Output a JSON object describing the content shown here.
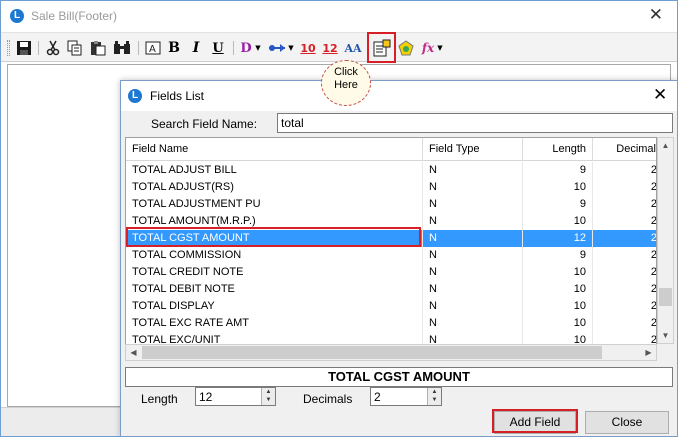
{
  "main_window": {
    "title": "Sale Bill(Footer)",
    "app_icon": "L",
    "close_glyph": "✕"
  },
  "toolbar": {
    "icons": [
      "save-icon",
      "cut-icon",
      "copy-icon",
      "paste-icon",
      "find-icon",
      "text-box-icon",
      "bold-icon",
      "italic-icon",
      "underline-icon",
      "data-field-icon",
      "shape-icon",
      "font-size-10-icon",
      "font-size-12-icon",
      "font-color-icon",
      "field-list-icon",
      "image-icon",
      "formula-icon"
    ],
    "bold_glyph": "B",
    "italic_glyph": "I",
    "underline_glyph": "U",
    "d_glyph": "D",
    "size10_glyph": "10",
    "size12_glyph": "12",
    "aa_glyph": "AA",
    "fx_glyph": "fx"
  },
  "callout": {
    "text_line1": "Click",
    "text_line2": "Here"
  },
  "fields_dialog": {
    "title": "Fields List",
    "close_glyph": "✕",
    "search_label": "Search Field Name:",
    "search_value": "total",
    "columns": [
      "Field Name",
      "Field Type",
      "Length",
      "Decimal"
    ],
    "rows": [
      {
        "name": "TOTAL ADJUST BILL",
        "type": "N",
        "length": "9",
        "decimal": "2"
      },
      {
        "name": "TOTAL ADJUST(RS)",
        "type": "N",
        "length": "10",
        "decimal": "2"
      },
      {
        "name": "TOTAL ADJUSTMENT PU",
        "type": "N",
        "length": "9",
        "decimal": "2"
      },
      {
        "name": "TOTAL AMOUNT(M.R.P.)",
        "type": "N",
        "length": "10",
        "decimal": "2"
      },
      {
        "name": "TOTAL CGST AMOUNT",
        "type": "N",
        "length": "12",
        "decimal": "2"
      },
      {
        "name": "TOTAL COMMISSION",
        "type": "N",
        "length": "9",
        "decimal": "2"
      },
      {
        "name": "TOTAL CREDIT NOTE",
        "type": "N",
        "length": "10",
        "decimal": "2"
      },
      {
        "name": "TOTAL DEBIT NOTE",
        "type": "N",
        "length": "10",
        "decimal": "2"
      },
      {
        "name": "TOTAL DISPLAY",
        "type": "N",
        "length": "10",
        "decimal": "2"
      },
      {
        "name": "TOTAL EXC RATE AMT",
        "type": "N",
        "length": "10",
        "decimal": "2"
      },
      {
        "name": "TOTAL EXC/UNIT",
        "type": "N",
        "length": "10",
        "decimal": "2"
      }
    ],
    "selected_row_index": 4,
    "selected_field_name": "TOTAL CGST AMOUNT",
    "length_label": "Length",
    "length_value": "12",
    "decimals_label": "Decimals",
    "decimals_value": "2",
    "add_field_label": "Add Field",
    "close_label": "Close"
  },
  "colors": {
    "selection": "#3399ff",
    "highlight_box": "#d61f26",
    "app_icon": "#1d78d1"
  }
}
